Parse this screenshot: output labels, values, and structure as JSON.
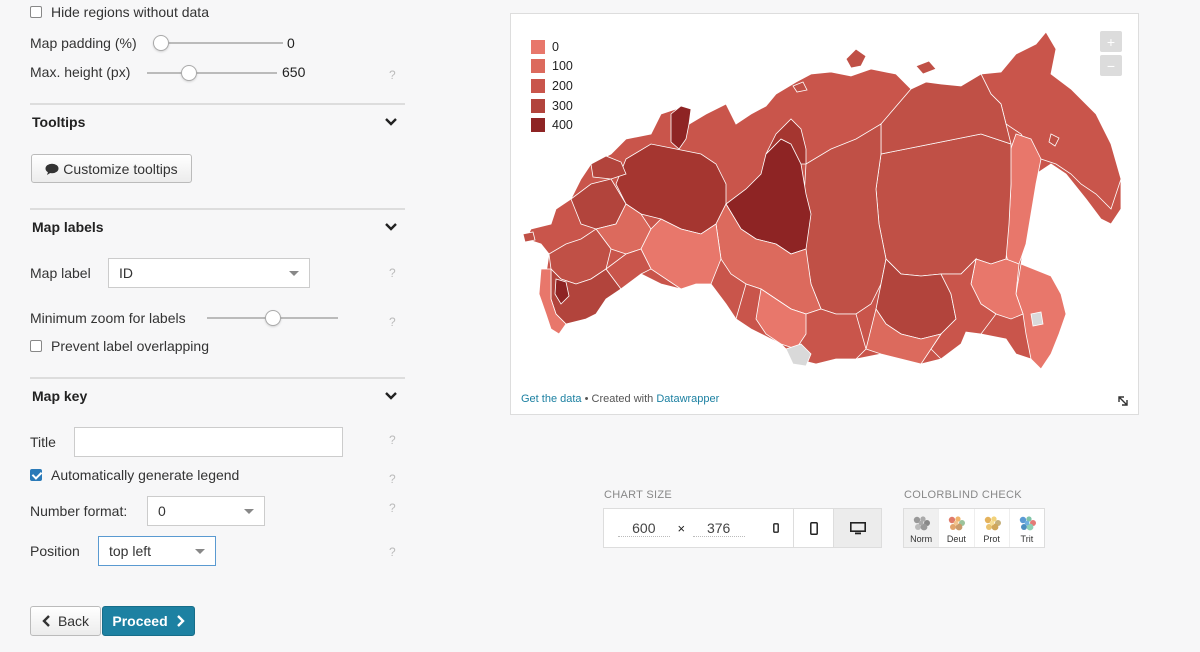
{
  "map_options": {
    "hide_regions_label": "Hide regions without data",
    "hide_regions_checked": false,
    "padding_label": "Map padding (%)",
    "padding_value": "0",
    "padding_level": 0,
    "maxheight_label": "Max. height (px)",
    "maxheight_value": "650",
    "maxheight_level": 0.3,
    "help": "?"
  },
  "tooltips": {
    "header": "Tooltips",
    "customize_button": "Customize tooltips"
  },
  "map_labels": {
    "header": "Map labels",
    "label_label": "Map label",
    "label_value": "ID",
    "min_zoom_label": "Minimum zoom for labels",
    "min_zoom_level": 0.5,
    "prevent_overlap_label": "Prevent label overlapping",
    "prevent_overlap_checked": false
  },
  "map_key": {
    "header": "Map key",
    "title_label": "Title",
    "title_value": "",
    "auto_legend_label": "Automatically generate legend",
    "auto_legend_checked": true,
    "number_format_label": "Number format:",
    "number_format_value": "0",
    "position_label": "Position",
    "position_value": "top left"
  },
  "nav": {
    "back_label": "Back",
    "proceed_label": "Proceed"
  },
  "preview": {
    "legend": [
      {
        "label": "0",
        "color": "#e8776b"
      },
      {
        "label": "100",
        "color": "#dc6a5d"
      },
      {
        "label": "200",
        "color": "#c9554b"
      },
      {
        "label": "300",
        "color": "#b2443c"
      },
      {
        "label": "400",
        "color": "#8e2424"
      }
    ],
    "zoom_in": "+",
    "zoom_out": "−",
    "footer_get_data": "Get the data",
    "footer_sep": " • Created with ",
    "footer_dw": "Datawrapper"
  },
  "chart_size": {
    "title": "CHART SIZE",
    "width": "600",
    "times": "×",
    "height": "376"
  },
  "colorblind": {
    "title": "COLORBLIND CHECK",
    "modes": [
      {
        "label": "Norm",
        "colors": [
          "#999",
          "#aaa",
          "#888",
          "#bbb",
          "#999",
          "#aaa"
        ]
      },
      {
        "label": "Deut",
        "colors": [
          "#e07b6a",
          "#f0b56b",
          "#9cc39b",
          "#e2a46c",
          "#c99b6b",
          "#f2c48e"
        ]
      },
      {
        "label": "Prot",
        "colors": [
          "#e4b25c",
          "#f2d27a",
          "#c5b07a",
          "#eac36f",
          "#d0a75a",
          "#f6de96"
        ]
      },
      {
        "label": "Trit",
        "colors": [
          "#5b9bd5",
          "#7fc4a8",
          "#e57a76",
          "#4c8fc0",
          "#8fd0b5",
          "#6fb0df"
        ]
      }
    ]
  },
  "colors": {
    "accent": "#1d81a2",
    "nodata": "#d9d9d9"
  }
}
